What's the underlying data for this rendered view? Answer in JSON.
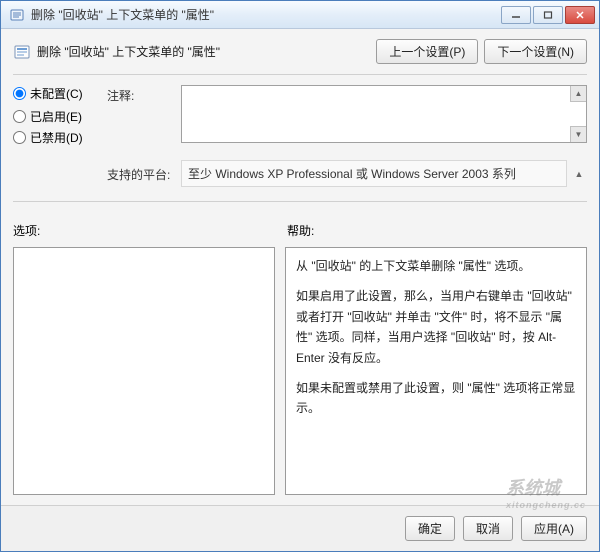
{
  "titlebar": {
    "title": "删除 \"回收站\" 上下文菜单的 \"属性\""
  },
  "window_btns": {
    "min": "—",
    "max": "□",
    "close": "✕"
  },
  "header": {
    "label": "删除 \"回收站\" 上下文菜单的 \"属性\"",
    "prev_btn": "上一个设置(P)",
    "next_btn": "下一个设置(N)"
  },
  "radios": {
    "not_configured": "未配置(C)",
    "enabled": "已启用(E)",
    "disabled": "已禁用(D)",
    "selected": "not_configured"
  },
  "fields": {
    "comment_label": "注释:",
    "comment_value": "",
    "platform_label": "支持的平台:",
    "platform_value": "至少 Windows XP Professional 或 Windows Server 2003 系列"
  },
  "sections": {
    "options_label": "选项:",
    "help_label": "帮助:"
  },
  "help": {
    "p1": "从 \"回收站\" 的上下文菜单删除 \"属性\" 选项。",
    "p2": "如果启用了此设置，那么，当用户右键单击 \"回收站\" 或者打开 \"回收站\" 并单击 \"文件\" 时，将不显示 \"属性\" 选项。同样，当用户选择 \"回收站\" 时，按 Alt-Enter 没有反应。",
    "p3": "如果未配置或禁用了此设置，则 \"属性\" 选项将正常显示。"
  },
  "footer": {
    "ok": "确定",
    "cancel": "取消",
    "apply": "应用(A)"
  },
  "watermark": {
    "main": "系统城",
    "sub": "xitongcheng.cc"
  }
}
